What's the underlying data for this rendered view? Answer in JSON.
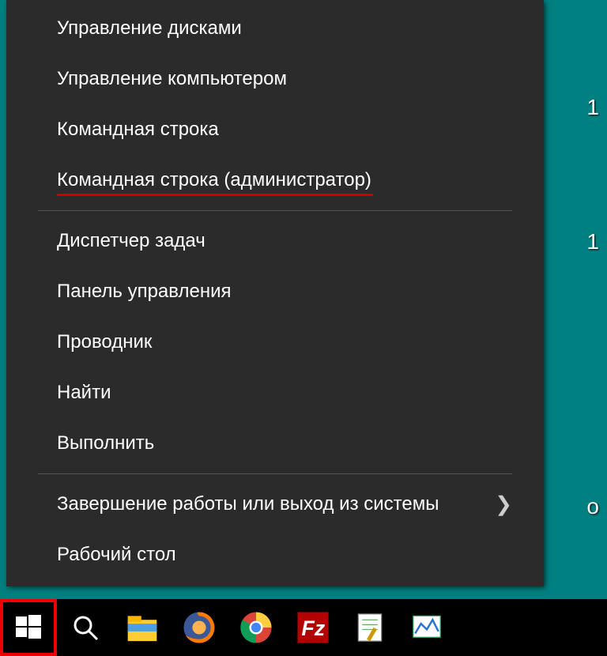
{
  "menu": {
    "items": [
      {
        "label": "Управление дисками",
        "name": "menu-item-disk-management",
        "has_submenu": false
      },
      {
        "label": "Управление компьютером",
        "name": "menu-item-computer-management",
        "has_submenu": false
      },
      {
        "label": "Командная строка",
        "name": "menu-item-command-prompt",
        "has_submenu": false
      },
      {
        "label": "Командная строка (администратор)",
        "name": "menu-item-command-prompt-admin",
        "has_submenu": false,
        "highlighted": true
      },
      {
        "sep": true
      },
      {
        "label": "Диспетчер задач",
        "name": "menu-item-task-manager",
        "has_submenu": false
      },
      {
        "label": "Панель управления",
        "name": "menu-item-control-panel",
        "has_submenu": false
      },
      {
        "label": "Проводник",
        "name": "menu-item-file-explorer",
        "has_submenu": false
      },
      {
        "label": "Найти",
        "name": "menu-item-search",
        "has_submenu": false
      },
      {
        "label": "Выполнить",
        "name": "menu-item-run",
        "has_submenu": false
      },
      {
        "sep": true
      },
      {
        "label": "Завершение работы или выход из системы",
        "name": "menu-item-shutdown-signout",
        "has_submenu": true
      },
      {
        "label": "Рабочий стол",
        "name": "menu-item-desktop",
        "has_submenu": false
      }
    ]
  },
  "taskbar": {
    "buttons": [
      {
        "name": "start-button",
        "icon": "windows-logo-icon"
      },
      {
        "name": "search-button",
        "icon": "search-icon"
      },
      {
        "name": "file-explorer-button",
        "icon": "file-explorer-icon"
      },
      {
        "name": "firefox-button",
        "icon": "firefox-icon"
      },
      {
        "name": "chrome-button",
        "icon": "chrome-icon"
      },
      {
        "name": "filezilla-button",
        "icon": "filezilla-icon"
      },
      {
        "name": "notepadpp-button",
        "icon": "notepadpp-icon"
      },
      {
        "name": "resource-monitor-button",
        "icon": "resource-monitor-icon"
      }
    ]
  },
  "annotation": {
    "start_highlighted": true
  }
}
